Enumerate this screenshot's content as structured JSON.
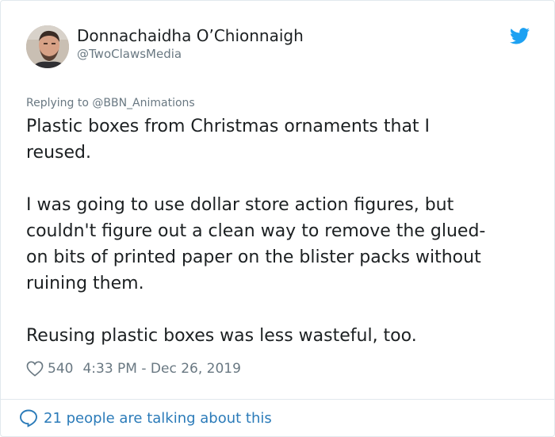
{
  "author": {
    "name": "Donnachaidha O’Chionnaigh",
    "handle": "@TwoClawsMedia"
  },
  "tweet": {
    "replying_to": "Replying to @BBN_Animations",
    "paragraphs": [
      "Plastic boxes from Christmas ornaments that I\nreused.",
      "I was going to use dollar store action figures, but\ncouldn't figure out a clean way to remove the glued-\non bits of printed paper on the blister packs without\nruining them.",
      "Reusing plastic boxes was less wasteful, too."
    ],
    "likes": "540",
    "timestamp": "4:33 PM - Dec 26, 2019"
  },
  "footer": {
    "conversation_label": "21 people are talking about this"
  },
  "icons": {
    "brand": "twitter-bird-icon",
    "like": "heart-icon",
    "reply": "speech-bubble-icon"
  },
  "colors": {
    "brand_blue": "#1da1f2",
    "link_blue": "#2b7bb9",
    "secondary_text": "#697882",
    "primary_text": "#1c2022",
    "border": "#e1e8ed"
  }
}
